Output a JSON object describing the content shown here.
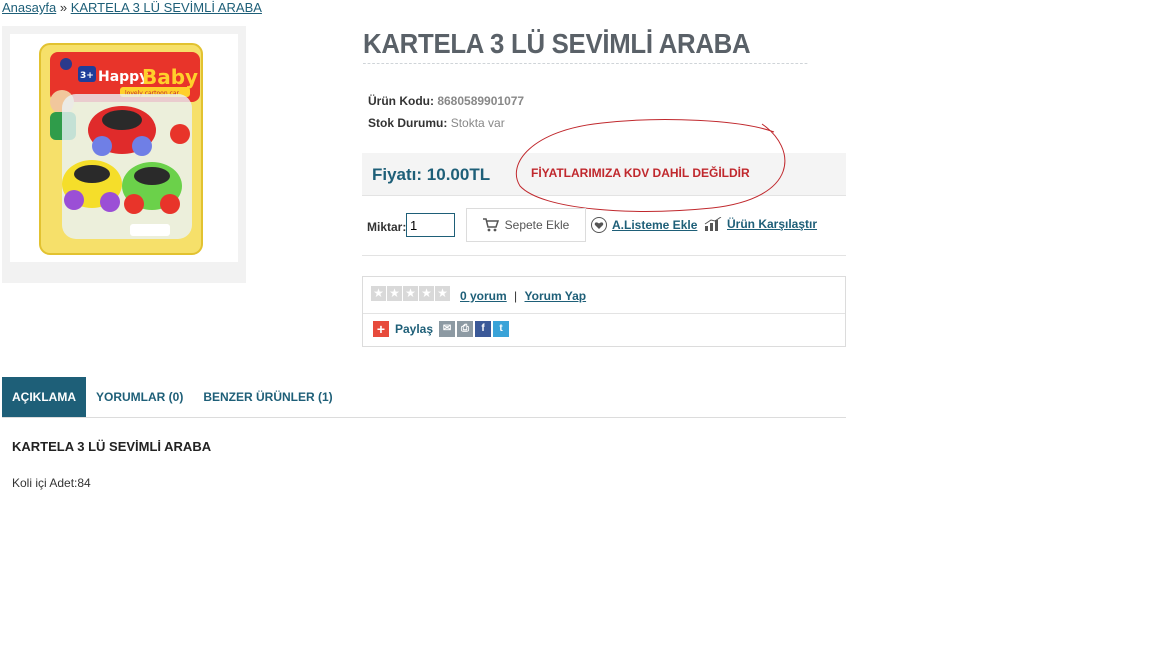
{
  "breadcrumb": {
    "home": "Anasayfa",
    "separator": "»",
    "current": "KARTELA 3 LÜ SEVİMLİ ARABA"
  },
  "product": {
    "title": "KARTELA 3 LÜ SEVİMLİ ARABA",
    "code_label": "Ürün Kodu:",
    "code_value": "8680589901077",
    "stock_label": "Stok Durumu:",
    "stock_value": "Stokta var",
    "price": "Fiyatı: 10.00TL",
    "annotation": "FİYATLARIMIZA KDV DAHİL DEĞİLDİR",
    "image_brand": "Happy Baby",
    "image_subtitle": "lovely cartoon car",
    "image_age": "3+"
  },
  "purchase": {
    "qty_label": "Miktar:",
    "qty_value": "1",
    "cart_label": "Sepete Ekle",
    "wishlist_label": "A.Listeme Ekle",
    "compare_label": "Ürün Karşılaştır"
  },
  "reviews": {
    "count_link": "0 yorum",
    "separator": "|",
    "write_link": "Yorum Yap",
    "rating": 0,
    "max_rating": 5
  },
  "share": {
    "label": "Paylaş",
    "icons": [
      "email-icon",
      "print-icon",
      "facebook-icon",
      "twitter-icon"
    ]
  },
  "tabs": [
    {
      "label": "AÇIKLAMA",
      "active": true
    },
    {
      "label": "YORUMLAR (0)",
      "active": false
    },
    {
      "label": "BENZER ÜRÜNLER (1)",
      "active": false
    }
  ],
  "description": {
    "title": "KARTELA 3 LÜ SEVİMLİ ARABA",
    "text": "Koli içi Adet:84"
  },
  "colors": {
    "accent": "#1e5f78",
    "title": "#5a6168",
    "annotation": "#c0282d"
  }
}
